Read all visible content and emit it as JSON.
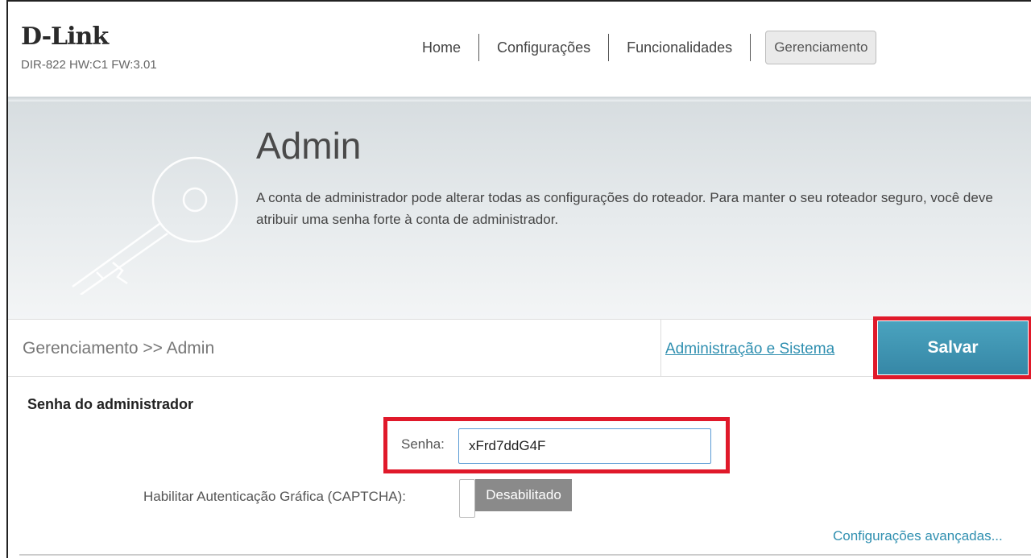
{
  "header": {
    "logo": "D-Link",
    "model": "DIR-822 HW:C1 FW:3.01",
    "nav": [
      {
        "label": "Home"
      },
      {
        "label": "Configurações"
      },
      {
        "label": "Funcionalidades"
      },
      {
        "label": "Gerenciamento",
        "active": true
      }
    ]
  },
  "banner": {
    "title": "Admin",
    "description": "A conta de administrador pode alterar todas as configurações do roteador. Para manter o seu roteador seguro, você deve atribuir uma senha forte à conta de administrador.",
    "icon": "key-icon"
  },
  "crumb_bar": {
    "breadcrumb": "Gerenciamento >> Admin",
    "system_link": "Administração e Sistema",
    "save_label": "Salvar"
  },
  "form": {
    "section_title": "Senha do administrador",
    "password_label": "Senha:",
    "password_value": "xFrd7ddG4F",
    "captcha_label": "Habilitar Autenticação Gráfica (CAPTCHA):",
    "captcha_state": "Desabilitado",
    "advanced_link": "Configurações avançadas..."
  },
  "colors": {
    "accent": "#3a8fae",
    "highlight": "#e0192a",
    "link": "#2f8fb0"
  }
}
